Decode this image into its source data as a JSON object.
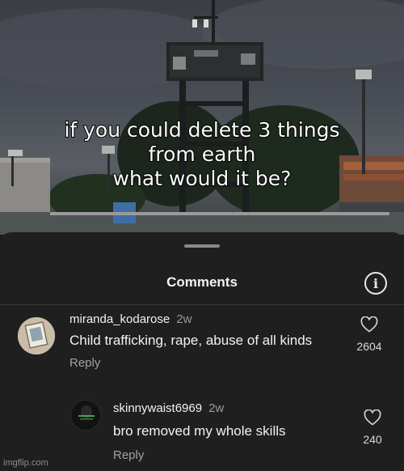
{
  "post": {
    "caption_lines": [
      "if you could delete 3 things",
      "from earth",
      "what would it be?"
    ]
  },
  "comments_panel": {
    "title": "Comments",
    "info_icon": "info-icon",
    "reply_label": "Reply"
  },
  "comments": [
    {
      "username": "miranda_kodarose",
      "time": "2w",
      "text": "Child trafficking, rape, abuse of all kinds",
      "likes": "2604"
    },
    {
      "username": "skinnywaist6969",
      "time": "2w",
      "text": "bro removed my whole skills",
      "likes": "240"
    }
  ],
  "watermark": "imgflip.com"
}
